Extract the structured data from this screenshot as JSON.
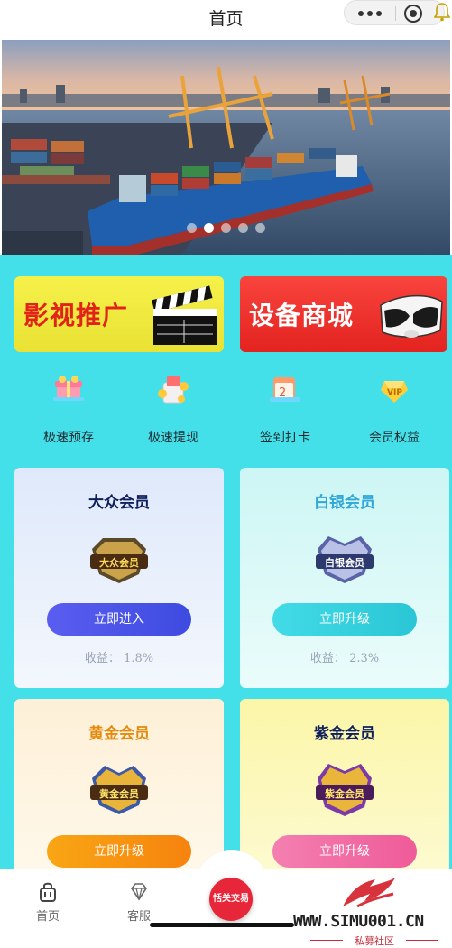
{
  "header": {
    "title": "首页"
  },
  "banner": {
    "slide_count": 5,
    "active_slide": 2
  },
  "promos": [
    {
      "label": "影视推广"
    },
    {
      "label": "设备商城"
    }
  ],
  "quick_actions": [
    {
      "label": "极速预存",
      "icon": "gift-box-icon"
    },
    {
      "label": "极速提现",
      "icon": "wallet-coins-icon"
    },
    {
      "label": "签到打卡",
      "icon": "calendar-checkin-icon"
    },
    {
      "label": "会员权益",
      "icon": "vip-crown-icon"
    }
  ],
  "membership_cards": [
    {
      "title": "大众会员",
      "badge_text": "大众会员",
      "button": "立即进入",
      "income_label": "收益：",
      "income_value": "1.8%"
    },
    {
      "title": "白银会员",
      "badge_text": "白银会员",
      "button": "立即升级",
      "income_label": "收益：",
      "income_value": "2.3%"
    },
    {
      "title": "黄金会员",
      "badge_text": "黄金会员",
      "button": "立即升级"
    },
    {
      "title": "紫金会员",
      "badge_text": "紫金会员",
      "button": "立即升级"
    }
  ],
  "tabbar": {
    "items": [
      {
        "label": "首页",
        "icon": "home-bag-icon"
      },
      {
        "label": "客服",
        "icon": "diamond-icon"
      }
    ],
    "center_label": "恬关交易"
  },
  "watermark": {
    "url": "WWW.SIMU001.CN",
    "subtitle": "私募社区"
  },
  "colors": {
    "page_bg": "#43e0ea",
    "accent_red": "#e8263a"
  }
}
